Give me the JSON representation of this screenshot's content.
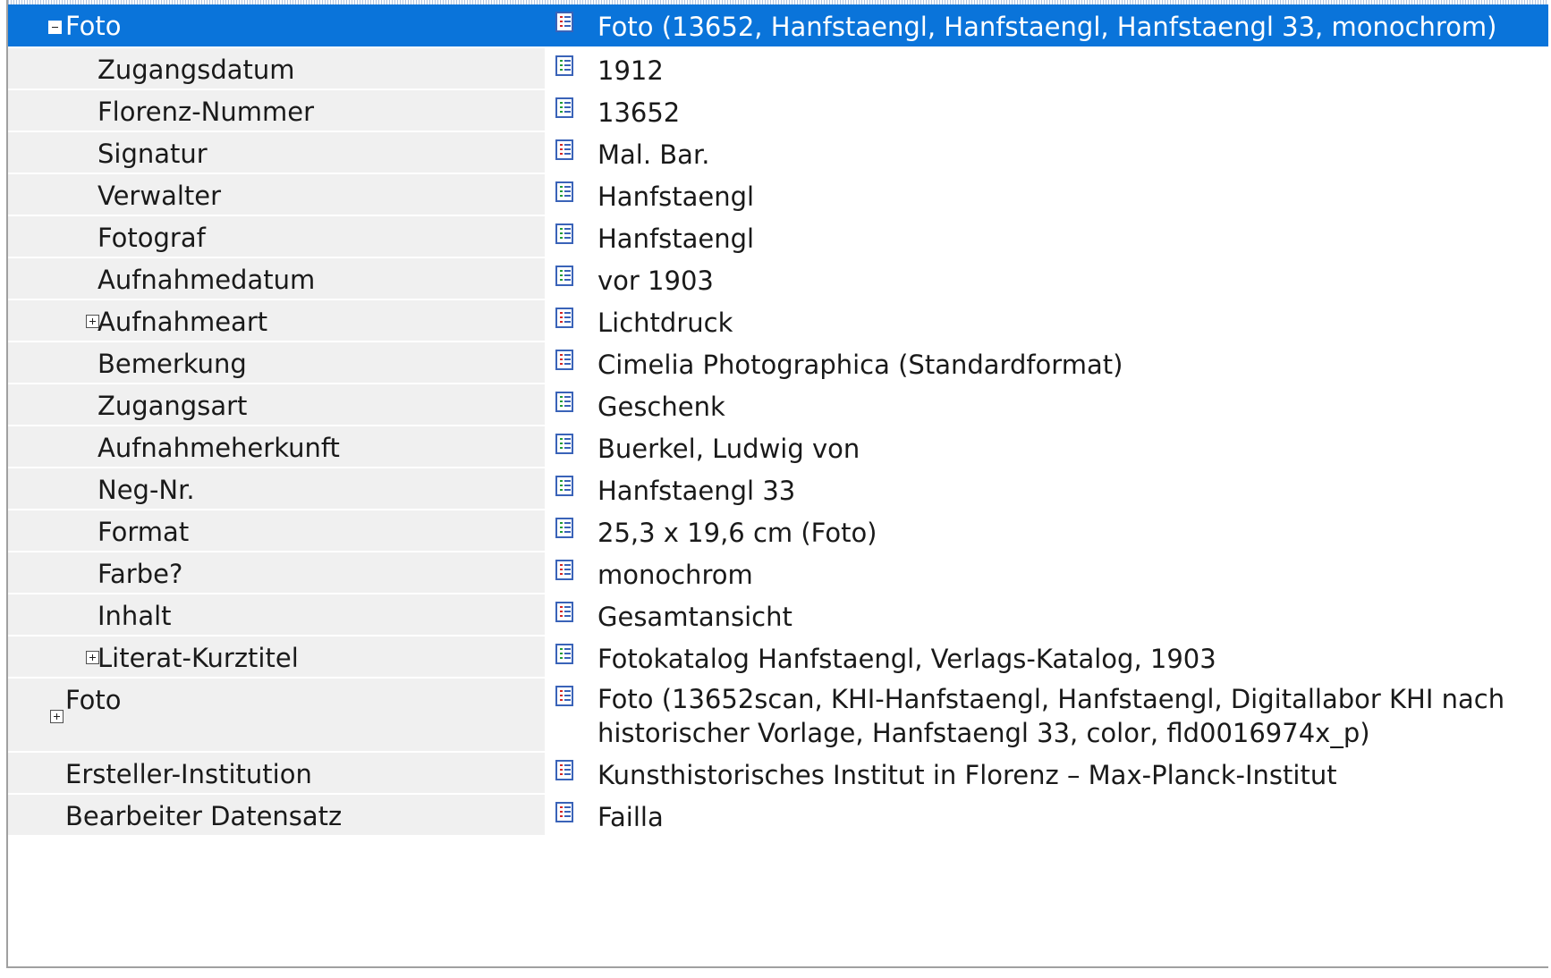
{
  "rows": [
    {
      "label": "Foto",
      "value": "Foto (13652, Hanfstaengl, Hanfstaengl, Hanfstaengl 33, monochrom)",
      "icon": "red-list-icon",
      "expander": "collapse"
    },
    {
      "label": "Zugangsdatum",
      "value": "1912",
      "icon": "green-list-icon"
    },
    {
      "label": "Florenz-Nummer",
      "value": "13652",
      "icon": "green-list-icon"
    },
    {
      "label": "Signatur",
      "value": "Mal. Bar.",
      "icon": "red-list-icon"
    },
    {
      "label": "Verwalter",
      "value": "Hanfstaengl",
      "icon": "green-list-icon"
    },
    {
      "label": "Fotograf",
      "value": "Hanfstaengl",
      "icon": "green-list-icon"
    },
    {
      "label": "Aufnahmedatum",
      "value": "vor 1903",
      "icon": "green-list-icon"
    },
    {
      "label": "Aufnahmeart",
      "value": "Lichtdruck",
      "icon": "red-list-icon",
      "expander": "expand"
    },
    {
      "label": "Bemerkung",
      "value": "Cimelia Photographica (Standardformat)",
      "icon": "red-list-icon"
    },
    {
      "label": "Zugangsart",
      "value": "Geschenk",
      "icon": "green-list-icon"
    },
    {
      "label": "Aufnahmeherkunft",
      "value": "Buerkel, Ludwig von",
      "icon": "green-list-icon"
    },
    {
      "label": "Neg-Nr.",
      "value": "Hanfstaengl 33",
      "icon": "green-list-icon"
    },
    {
      "label": "Format",
      "value": "25,3 x 19,6 cm (Foto)",
      "icon": "green-list-icon"
    },
    {
      "label": "Farbe?",
      "value": "monochrom",
      "icon": "red-list-icon"
    },
    {
      "label": "Inhalt",
      "value": "Gesamtansicht",
      "icon": "red-list-icon"
    },
    {
      "label": "Literat-Kurztitel",
      "value": "Fotokatalog Hanfstaengl, Verlags-Katalog, 1903",
      "icon": "green-list-icon",
      "expander": "expand"
    },
    {
      "label": "Foto",
      "value": "Foto (13652scan, KHI-Hanfstaengl, Hanfstaengl, Digitallabor KHI nach historischer Vorlage, Hanfstaengl 33, color, fld0016974x_p)",
      "icon": "red-list-icon",
      "expander": "expand"
    },
    {
      "label": "Ersteller-Institution",
      "value": "Kunsthistorisches Institut in Florenz – Max-Planck-Institut",
      "icon": "red-list-icon"
    },
    {
      "label": "Bearbeiter Datensatz",
      "value": "Failla",
      "icon": "red-list-icon"
    }
  ],
  "colors": {
    "selection": "#0a74da",
    "label_background": "#f0f0f0",
    "icon_red": "#d22525",
    "icon_green": "#1f9b36",
    "icon_blue": "#3a63b8"
  }
}
